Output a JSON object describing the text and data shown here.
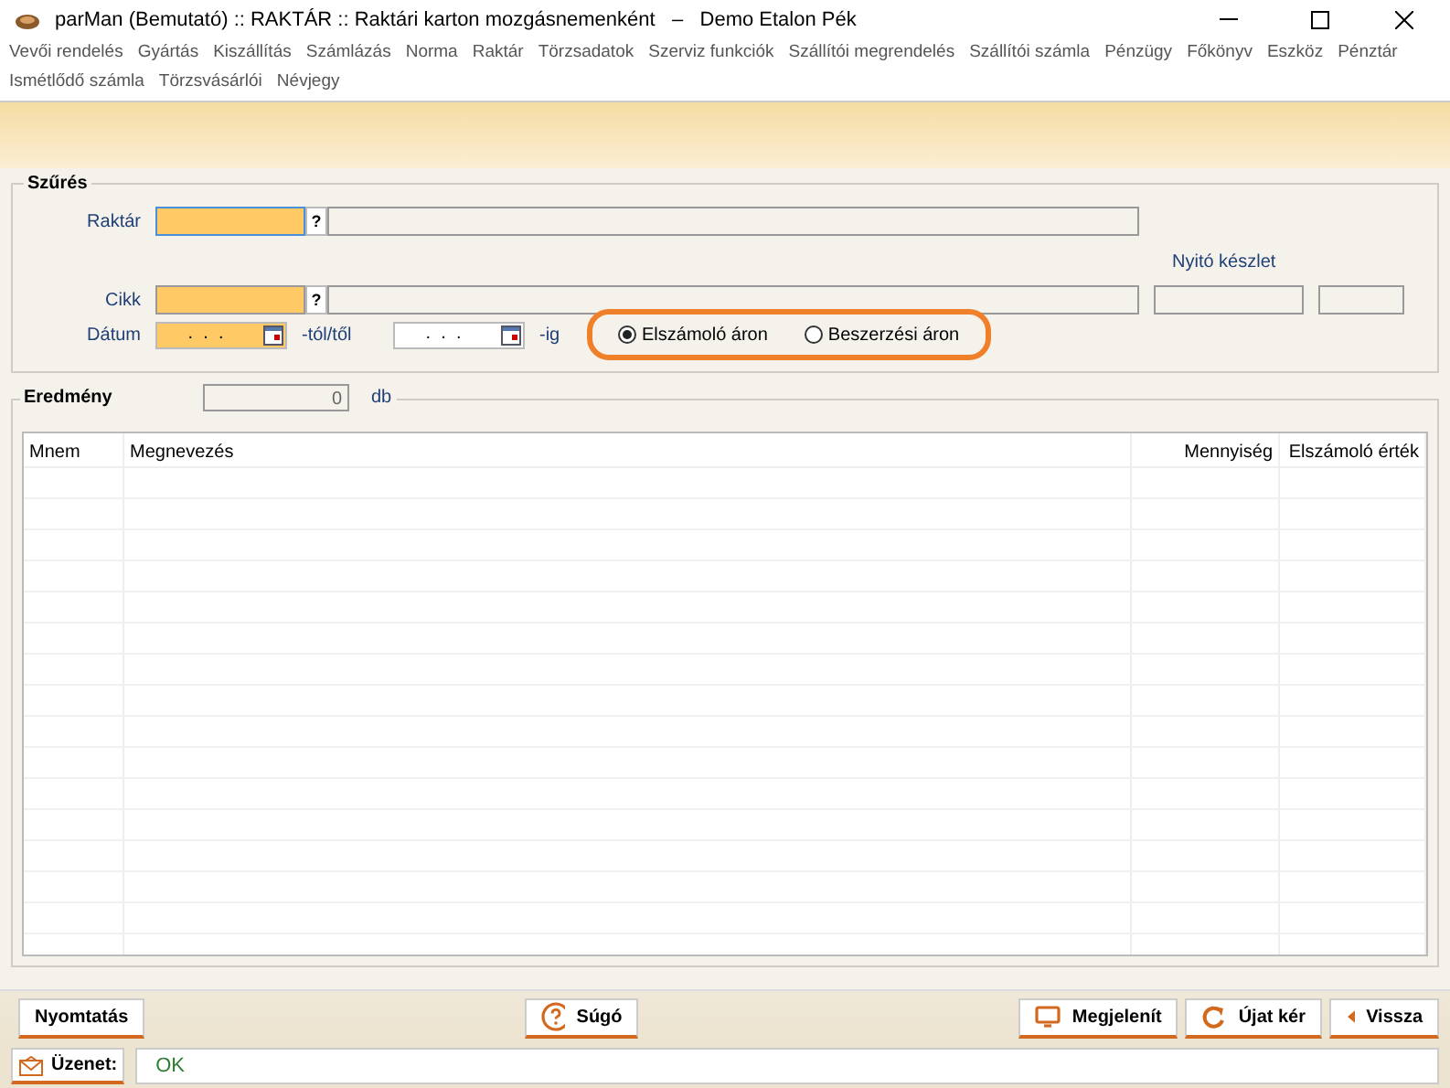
{
  "window": {
    "title": "parMan (Bemutató) :: RAKTÁR :: Raktári karton mozgásnemenként   –   Demo Etalon Pék"
  },
  "menu": [
    "Vevői rendelés",
    "Gyártás",
    "Kiszállítás",
    "Számlázás",
    "Norma",
    "Raktár",
    "Törzsadatok",
    "Szerviz funkciók",
    "Szállítói megrendelés",
    "Szállítói számla",
    "Pénzügy",
    "Főkönyv",
    "Eszköz",
    "Pénztár",
    "Ismétlődő számla",
    "Törzsvásárlói",
    "Névjegy"
  ],
  "filter": {
    "title": "Szűrés",
    "warehouse_label": "Raktár",
    "lookup_button": "?",
    "item_label": "Cikk",
    "item_lookup_button": "?",
    "opening_stock_label": "Nyitó készlet",
    "date_label": "Dátum",
    "date_from": " .  .  .",
    "from_suffix": "-tól/től",
    "date_to": " .  .  .",
    "to_suffix": "-ig",
    "price_options": [
      {
        "label": "Elszámoló áron",
        "selected": true
      },
      {
        "label": "Beszerzési áron",
        "selected": false
      }
    ]
  },
  "result": {
    "title": "Eredmény",
    "count": "0",
    "unit": "db"
  },
  "table": {
    "columns": [
      "Mnem",
      "Megnevezés",
      "Mennyiség",
      "Elszámoló érték"
    ]
  },
  "buttons": [
    {
      "label": "Nyomtatás",
      "kind": "plain"
    },
    {
      "label": "Súgó",
      "kind": "help"
    },
    {
      "label": "Megjelenít",
      "kind": "display"
    },
    {
      "label": "Újat kér",
      "kind": "refresh"
    },
    {
      "label": "Vissza",
      "kind": "back"
    }
  ],
  "status_bar": {
    "label": "Üzenet:",
    "message": "OK"
  }
}
